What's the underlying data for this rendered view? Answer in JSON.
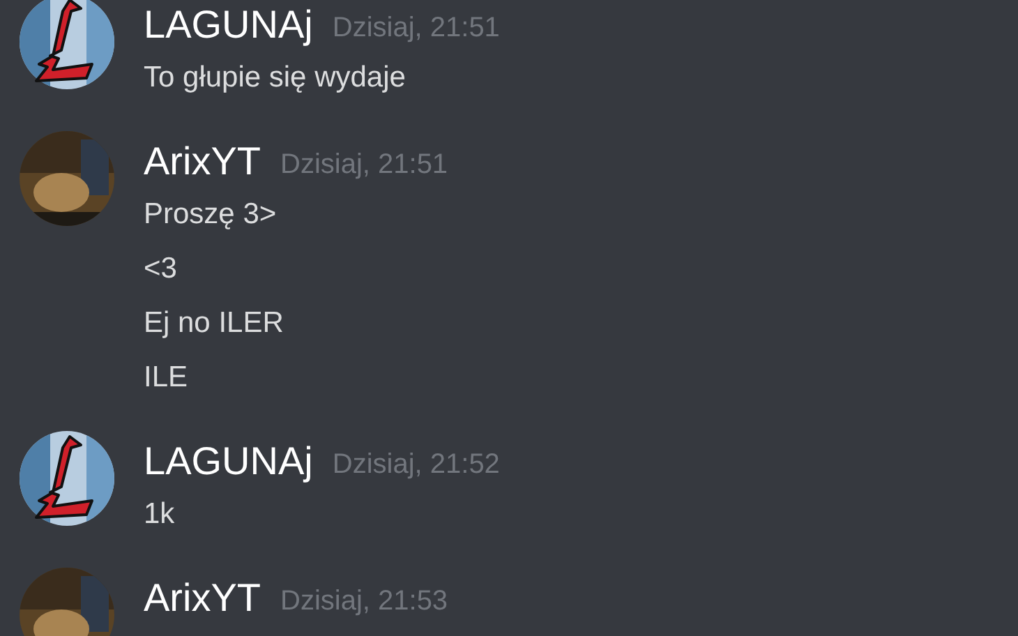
{
  "messages": [
    {
      "author": "LAGUNAj",
      "timestamp": "Dzisiaj, 21:51",
      "avatar": {
        "kind": "logo"
      },
      "lines": [
        "To głupie się wydaje"
      ]
    },
    {
      "author": "ArixYT",
      "timestamp": "Dzisiaj, 21:51",
      "avatar": {
        "kind": "photo"
      },
      "lines": [
        "Proszę 3>",
        "<3",
        "Ej no ILER",
        "ILE"
      ]
    },
    {
      "author": "LAGUNAj",
      "timestamp": "Dzisiaj, 21:52",
      "avatar": {
        "kind": "logo"
      },
      "lines": [
        "1k"
      ]
    },
    {
      "author": "ArixYT",
      "timestamp": "Dzisiaj, 21:53",
      "avatar": {
        "kind": "photo"
      }
    }
  ]
}
